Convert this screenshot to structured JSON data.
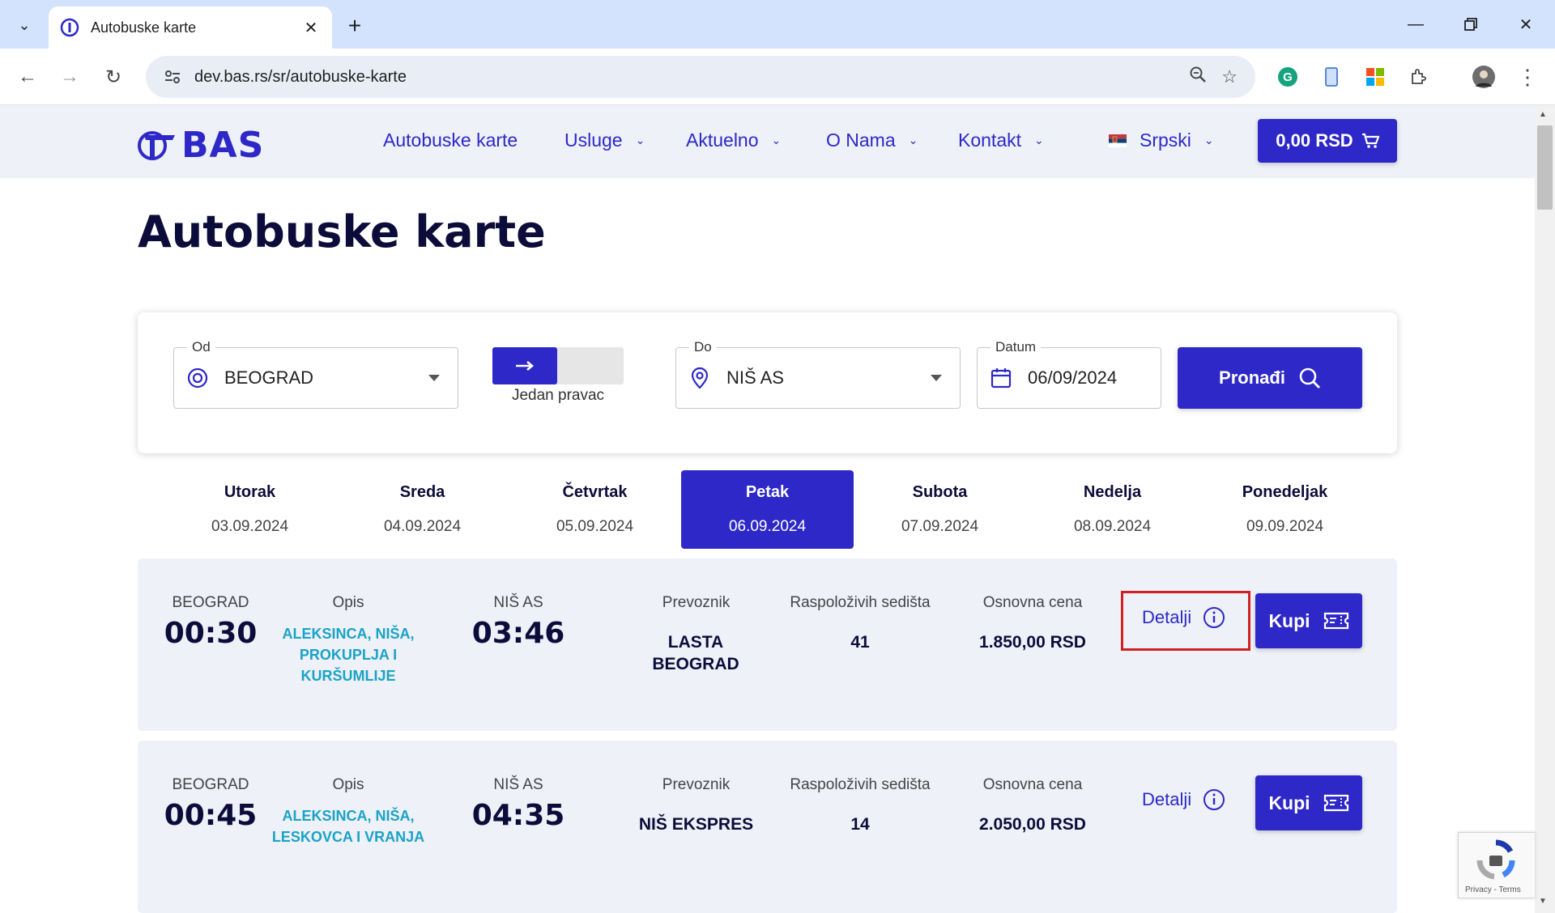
{
  "browser": {
    "tab_title": "Autobuske karte",
    "url": "dev.bas.rs/sr/autobuske-karte"
  },
  "site": {
    "logo_text": "BAS",
    "nav": [
      {
        "label": "Autobuske karte"
      },
      {
        "label": "Usluge"
      },
      {
        "label": "Aktuelno"
      },
      {
        "label": "O Nama"
      },
      {
        "label": "Kontakt"
      }
    ],
    "language": "Srpski",
    "cart_total": "0,00 RSD",
    "brand_color": "#2d28c7"
  },
  "page_title": "Autobuske karte",
  "search": {
    "from_label": "Od",
    "from_value": "BEOGRAD",
    "direction_label": "Jedan pravac",
    "to_label": "Do",
    "to_value": "NIŠ AS",
    "date_label": "Datum",
    "date_value": "06/09/2024",
    "submit_label": "Pronađi"
  },
  "days": [
    {
      "name": "Utorak",
      "date": "03.09.2024"
    },
    {
      "name": "Sreda",
      "date": "04.09.2024"
    },
    {
      "name": "Četvrtak",
      "date": "05.09.2024"
    },
    {
      "name": "Petak",
      "date": "06.09.2024",
      "active": true
    },
    {
      "name": "Subota",
      "date": "07.09.2024"
    },
    {
      "name": "Nedelja",
      "date": "08.09.2024"
    },
    {
      "name": "Ponedeljak",
      "date": "09.09.2024"
    }
  ],
  "results": [
    {
      "from": "BEOGRAD",
      "departure": "00:30",
      "desc_label": "Opis",
      "desc": "ALEKSINCA, NIŠA, PROKUPLJA I KURŠUMLIJE",
      "to": "NIŠ AS",
      "arrival": "03:46",
      "carrier_label": "Prevoznik",
      "carrier": "LASTA BEOGRAD",
      "seats_label": "Raspoloživih sedišta",
      "seats": "41",
      "price_label": "Osnovna cena",
      "price": "1.850,00 RSD",
      "details_label": "Detalji",
      "buy_label": "Kupi"
    },
    {
      "from": "BEOGRAD",
      "departure": "00:45",
      "desc_label": "Opis",
      "desc": "ALEKSINCA, NIŠA, LESKOVCA I VRANJA",
      "to": "NIŠ AS",
      "arrival": "04:35",
      "carrier_label": "Prevoznik",
      "carrier": "NIŠ EKSPRES",
      "seats_label": "Raspoloživih sedišta",
      "seats": "14",
      "price_label": "Osnovna cena",
      "price": "2.050,00 RSD",
      "details_label": "Detalji",
      "buy_label": "Kupi"
    }
  ],
  "recaptcha_text": "Privacy - Terms"
}
